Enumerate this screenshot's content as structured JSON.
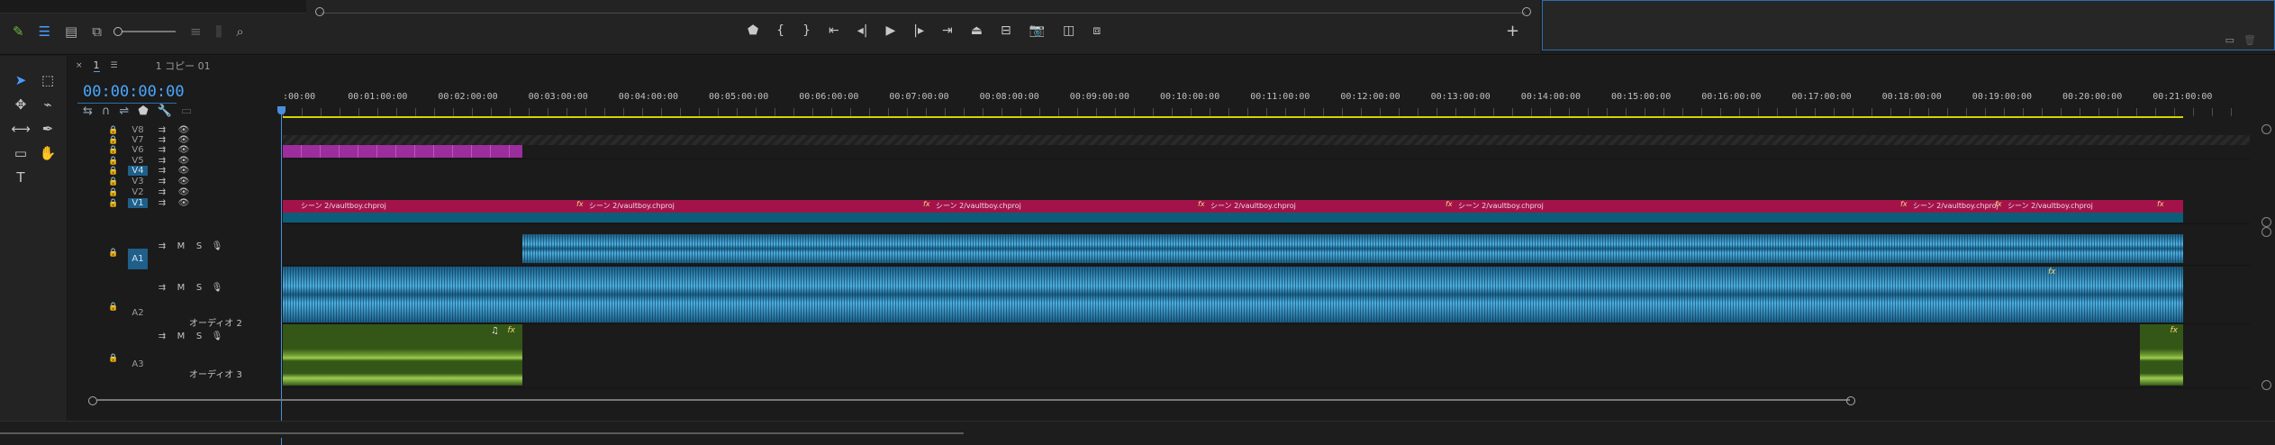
{
  "source_controls": {
    "icons": [
      "pencil-icon",
      "list-view-icon",
      "icon-view-icon",
      "freeform-view-icon",
      "zoom-slider",
      "sort-icon",
      "automate-icon",
      "search-icon"
    ]
  },
  "program_controls": {
    "icons": [
      "add-marker-icon",
      "mark-in-icon",
      "mark-out-icon",
      "go-to-in-icon",
      "step-back-icon",
      "play-icon",
      "step-forward-icon",
      "go-to-out-icon",
      "lift-icon",
      "extract-icon",
      "export-frame-icon",
      "comparison-view-icon",
      "trim-icon",
      "add-button-icon"
    ]
  },
  "timeline": {
    "tabs": [
      {
        "label": "1",
        "active": true
      },
      {
        "label": "1 コピー 01",
        "active": false
      }
    ],
    "timecode": "00:00:00:00",
    "ruler_labels": [
      ":00:00",
      "00:01:00:00",
      "00:02:00:00",
      "00:03:00:00",
      "00:04:00:00",
      "00:05:00:00",
      "00:06:00:00",
      "00:07:00:00",
      "00:08:00:00",
      "00:09:00:00",
      "00:10:00:00",
      "00:11:00:00",
      "00:12:00:00",
      "00:13:00:00",
      "00:14:00:00",
      "00:15:00:00",
      "00:16:00:00",
      "00:17:00:00",
      "00:18:00:00",
      "00:19:00:00",
      "00:20:00:00",
      "00:21:00:00"
    ],
    "video_tracks": [
      {
        "label": "V8",
        "targeted": false
      },
      {
        "label": "V7",
        "targeted": false
      },
      {
        "label": "V6",
        "targeted": false
      },
      {
        "label": "V5",
        "targeted": false
      },
      {
        "label": "V4",
        "targeted": true
      },
      {
        "label": "V3",
        "targeted": false
      },
      {
        "label": "V2",
        "targeted": false
      },
      {
        "label": "V1",
        "targeted": true
      }
    ],
    "audio_tracks": [
      {
        "label": "A1",
        "name": "",
        "targeted": true,
        "m": "M",
        "s": "S"
      },
      {
        "label": "A2",
        "name": "オーディオ 2",
        "targeted": false,
        "m": "M",
        "s": "S"
      },
      {
        "label": "A3",
        "name": "オーディオ 3",
        "targeted": false,
        "m": "M",
        "s": "S"
      }
    ],
    "v2_clips": [
      {
        "label": "シーン 2/vaultboy.chproj",
        "fx": "fx"
      },
      {
        "label": "シーン 2/vaultboy.chproj",
        "fx": "fx"
      },
      {
        "label": "シーン 2/vaultboy.chproj",
        "fx": "fx"
      },
      {
        "label": "シーン 2/vaultboy.chproj",
        "fx": "fx"
      },
      {
        "label": "シーン 2/vaultboy.chproj",
        "fx": "fx"
      },
      {
        "label": "シーン 2/vaultboy.chproj",
        "fx": "fx"
      },
      {
        "label": "シーン 2/vaultboy.chproj",
        "fx": "fx"
      }
    ],
    "fx_badge": "fx",
    "music_note": "♫"
  },
  "colors": {
    "accent": "#4aa8ff",
    "v2_clip": "#a3134a",
    "v1_clip": "#0c5d78",
    "v6_clip": "#9b2d9c",
    "audio_blue": "#4bb0e0",
    "audio_green": "#6f9a31",
    "work_area": "#d6d200"
  }
}
